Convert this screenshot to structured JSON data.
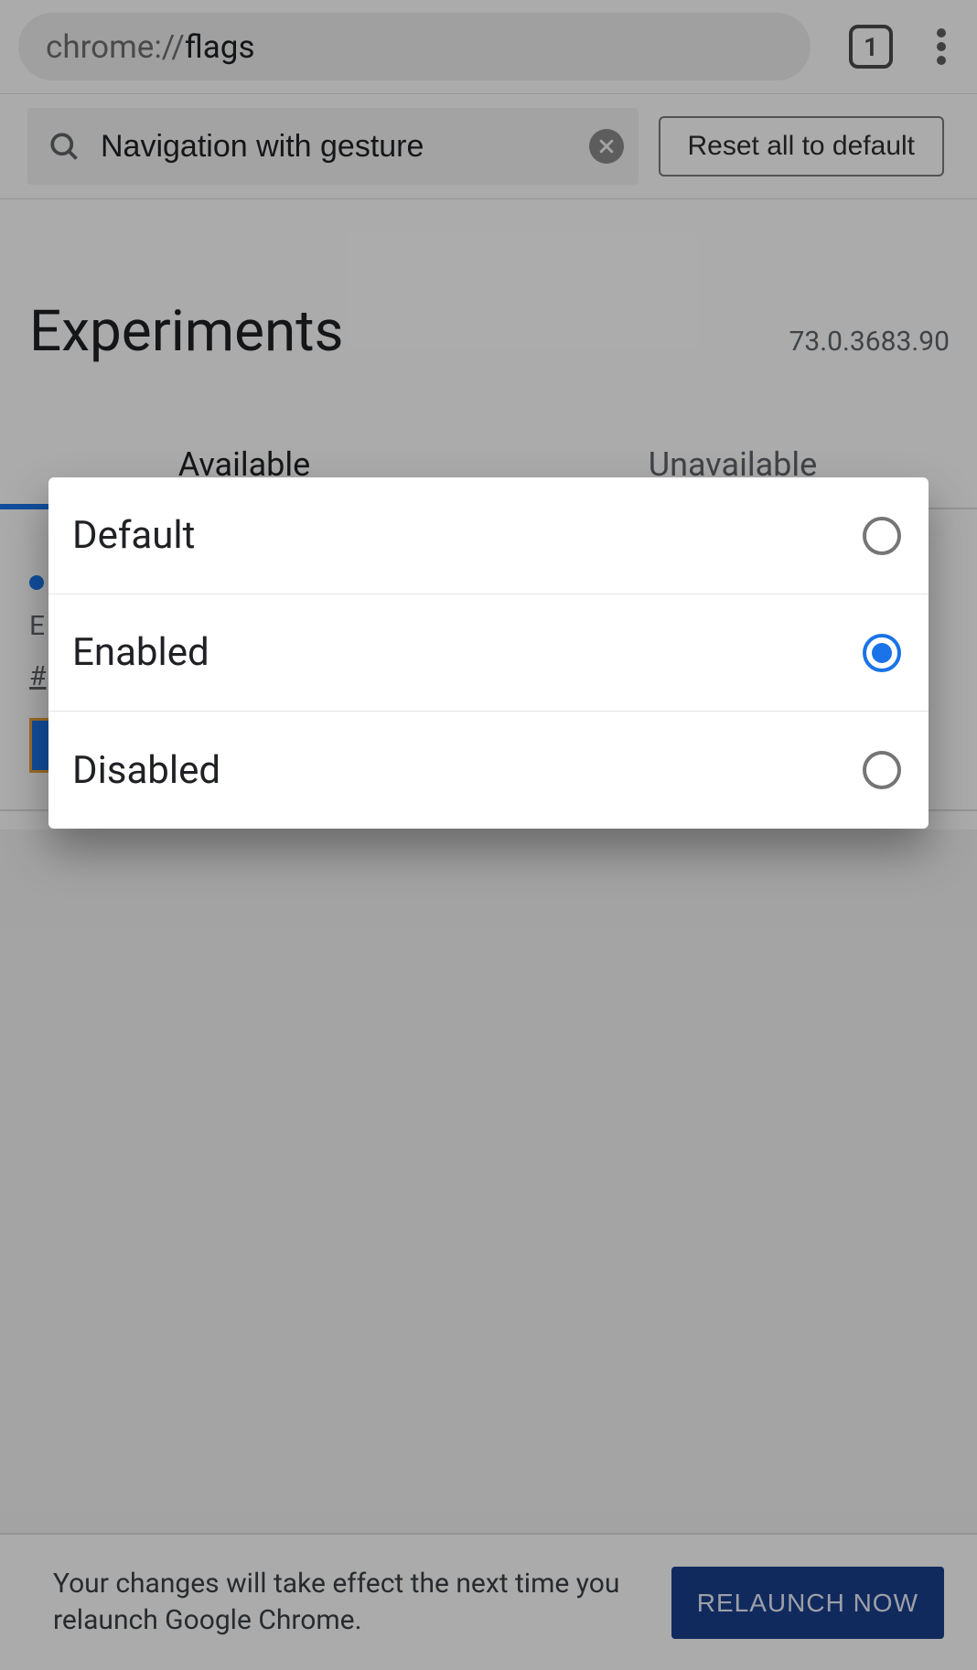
{
  "omnibar": {
    "url_scheme": "chrome://",
    "url_path": "flags",
    "tab_count": "1"
  },
  "toolbar": {
    "search_value": "Navigation with gesture",
    "reset_label": "Reset all to default"
  },
  "page": {
    "title": "Experiments",
    "version": "73.0.3683.90",
    "tabs": {
      "available": "Available",
      "unavailable": "Unavailable"
    },
    "flag": {
      "desc_prefix": "E",
      "hash_prefix": "#"
    }
  },
  "dialog": {
    "options": [
      {
        "label": "Default",
        "selected": false
      },
      {
        "label": "Enabled",
        "selected": true
      },
      {
        "label": "Disabled",
        "selected": false
      }
    ]
  },
  "footer": {
    "message": "Your changes will take effect the next time you relaunch Google Chrome.",
    "button": "RELAUNCH NOW"
  }
}
